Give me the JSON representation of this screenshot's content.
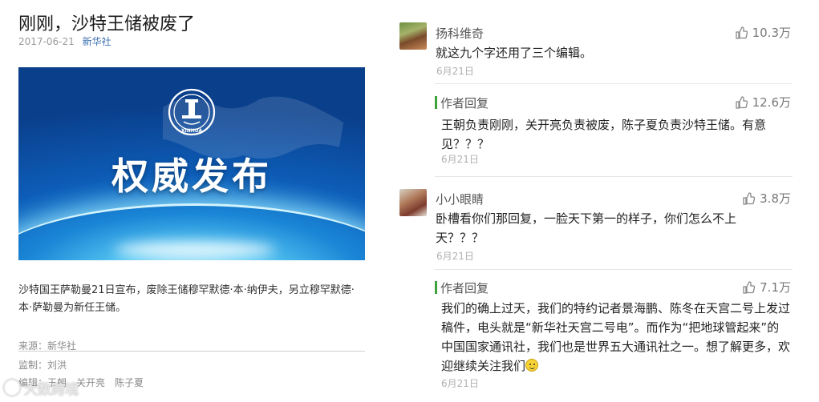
{
  "article": {
    "title": "刚刚，沙特王储被废了",
    "date": "2017-06-21",
    "source_link": "新华社",
    "banner": {
      "logo_text": "XINHUA",
      "headline": "权威发布"
    },
    "body": "沙特国王萨勒曼21日宣布，废除王储穆罕默德·本·纳伊夫，另立穆罕默德·本·萨勒曼为新任王储。",
    "footer": {
      "source": "来源：新华社",
      "supervisor": "监制：刘洪",
      "editors": "编辑：王朝　关开亮　陈子夏"
    }
  },
  "watermark": "大数跨境",
  "comments": [
    {
      "user": "扬科维奇",
      "likes": "10.3万",
      "text": "就这九个字还用了三个编辑。",
      "date": "6月21日",
      "reply": {
        "label": "作者回复",
        "likes": "12.6万",
        "text": "王朝负责刚刚，关开亮负责被废，陈子夏负责沙特王储。有意见？？？",
        "date": "6月21日"
      }
    },
    {
      "user": "小小眼睛",
      "likes": "3.8万",
      "text": "卧槽看你们那回复，一脸天下第一的样子，你们怎么不上天？？？",
      "date": "6月21日",
      "reply": {
        "label": "作者回复",
        "likes": "7.1万",
        "text": "我们的确上过天，我们的特约记者景海鹏、陈冬在天宫二号上发过稿件，电头就是“新华社天宫二号电”。而作为“把地球管起来”的中国国家通讯社，我们也是世界五大通讯社之一。想了解更多，欢迎继续关注我们",
        "date": "6月21日"
      }
    }
  ],
  "colors": {
    "accent_link": "#3b6fb0",
    "reply_bar": "#3fa33b",
    "banner_blue": "#0d5db8"
  }
}
